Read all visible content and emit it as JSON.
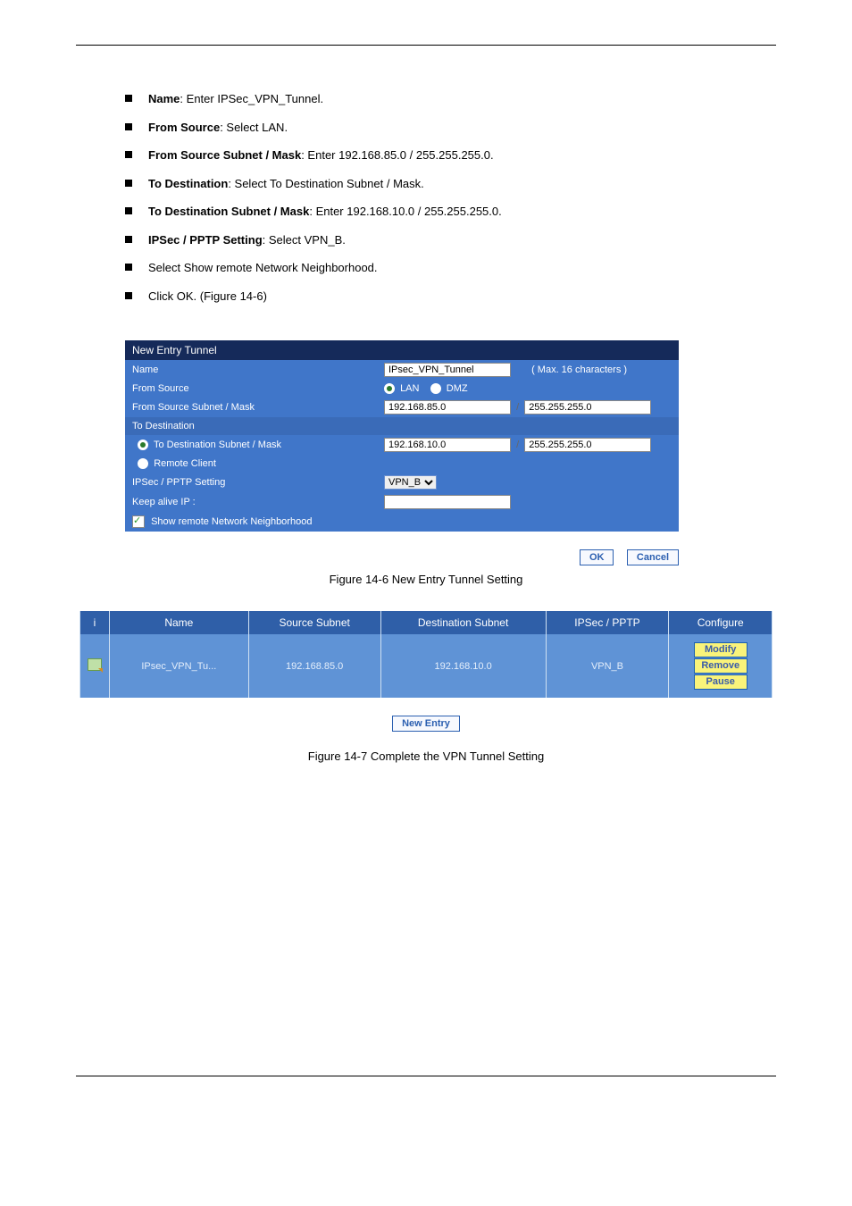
{
  "bullets": [
    {
      "label": "Name",
      "rest": ": Enter IPSec_VPN_Tunnel."
    },
    {
      "label": "From Source",
      "rest": ": Select LAN."
    },
    {
      "label": "From Source Subnet / Mask",
      "rest": ": Enter 192.168.85.0 / 255.255.255.0."
    },
    {
      "label": "To Destination",
      "rest": ": Select To Destination Subnet / Mask."
    },
    {
      "label": "To Destination Subnet / Mask",
      "rest": ": Enter 192.168.10.0 / 255.255.255.0."
    },
    {
      "label": "IPSec / PPTP Setting",
      "rest": ": Select VPN_B."
    },
    {
      "label": "",
      "rest": "Select Show remote Network Neighborhood."
    },
    {
      "label": "",
      "rest": "Click OK. (Figure 14-6)"
    }
  ],
  "form": {
    "header": "New Entry Tunnel",
    "name_label": "Name",
    "name_value": "IPsec_VPN_Tunnel",
    "name_hint": "( Max. 16 characters )",
    "from_source_label": "From Source",
    "from_source_lan": "LAN",
    "from_source_dmz": "DMZ",
    "from_subnet_label": "From Source Subnet / Mask",
    "from_subnet_ip": "192.168.85.0",
    "from_subnet_mask": "255.255.255.0",
    "to_dest_header": "To Destination",
    "to_dest_subnet_opt": "To Destination Subnet / Mask",
    "to_subnet_ip": "192.168.10.0",
    "to_subnet_mask": "255.255.255.0",
    "remote_client_opt": "Remote Client",
    "ipsec_label": "IPSec / PPTP Setting",
    "ipsec_value": "VPN_B",
    "keep_alive_label": "Keep alive IP :",
    "keep_alive_value": "",
    "show_remote_label": "Show remote Network Neighborhood"
  },
  "ok_label": "OK",
  "cancel_label": "Cancel",
  "fig_caption1": "Figure 14-6 New Entry Tunnel Setting",
  "summary": {
    "headers": {
      "i": "i",
      "name": "Name",
      "source": "Source Subnet",
      "dest": "Destination Subnet",
      "ipsec": "IPSec / PPTP",
      "cfg": "Configure"
    },
    "row": {
      "name": "IPsec_VPN_Tu...",
      "source": "192.168.85.0",
      "dest": "192.168.10.0",
      "ipsec": "VPN_B"
    },
    "modify": "Modify",
    "remove": "Remove",
    "pause": "Pause",
    "new_entry": "New Entry"
  },
  "fig_caption2": "Figure 14-7 Complete the VPN Tunnel Setting"
}
